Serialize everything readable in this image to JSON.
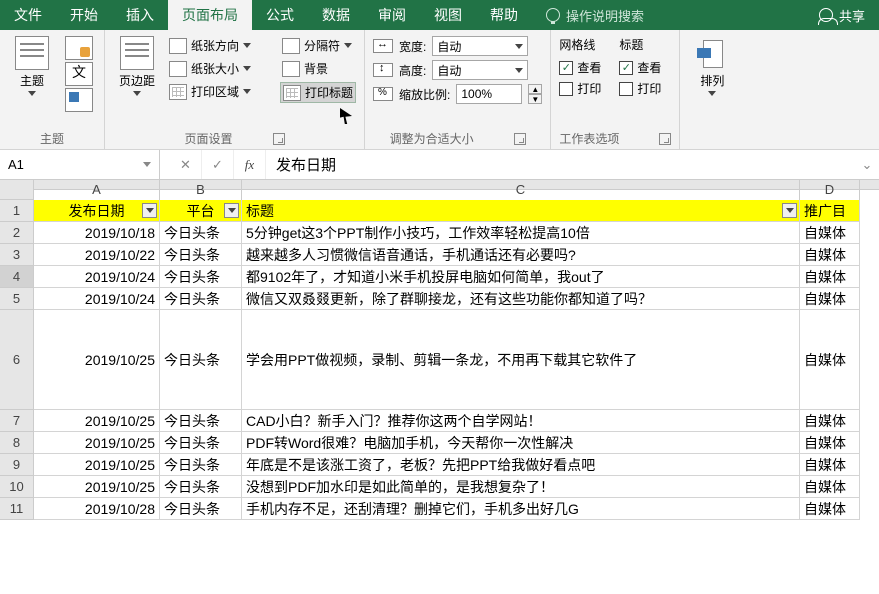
{
  "tabs": {
    "file": "文件",
    "home": "开始",
    "insert": "插入",
    "layout": "页面布局",
    "formulas": "公式",
    "data": "数据",
    "review": "审阅",
    "view": "视图",
    "help": "帮助",
    "tell": "操作说明搜索",
    "share": "共享"
  },
  "ribbon": {
    "themes": {
      "theme": "主题",
      "colors_icon": "colors-icon",
      "fonts_icon": "fonts-icon",
      "effects_icon": "effects-icon",
      "group": "主题"
    },
    "page": {
      "margins": "页边距",
      "orientation": "纸张方向",
      "size": "纸张大小",
      "printarea": "打印区域",
      "breaks": "分隔符",
      "background": "背景",
      "printtitles": "打印标题",
      "group": "页面设置"
    },
    "scale": {
      "width": "宽度:",
      "height": "高度:",
      "scale": "缩放比例:",
      "auto": "自动",
      "pct": "100%",
      "group": "调整为合适大小"
    },
    "options": {
      "gridlines": "网格线",
      "headings": "标题",
      "view": "查看",
      "print": "打印",
      "group": "工作表选项"
    },
    "arrange": {
      "arrange": "排列"
    }
  },
  "namebox": "A1",
  "formula": "发布日期",
  "columns": {
    "A": "A",
    "B": "B",
    "C": "C",
    "D": "D"
  },
  "headers": {
    "A": "发布日期",
    "B": "平台",
    "C": "标题",
    "D": "推广目"
  },
  "rows": [
    {
      "n": "2",
      "A": "2019/10/18",
      "B": "今日头条",
      "C": "5分钟get这3个PPT制作小技巧，工作效率轻松提高10倍",
      "D": "自媒体"
    },
    {
      "n": "3",
      "A": "2019/10/22",
      "B": "今日头条",
      "C": "越来越多人习惯微信语音通话，手机通话还有必要吗?",
      "D": "自媒体"
    },
    {
      "n": "4",
      "A": "2019/10/24",
      "B": "今日头条",
      "C": "都9102年了，才知道小米手机投屏电脑如何简单，我out了",
      "D": "自媒体"
    },
    {
      "n": "5",
      "A": "2019/10/24",
      "B": "今日头条",
      "C": "微信又双叒叕更新，除了群聊接龙，还有这些功能你都知道了吗？",
      "D": "自媒体"
    },
    {
      "n": "6",
      "A": "2019/10/25",
      "B": "今日头条",
      "C": "学会用PPT做视频，录制、剪辑一条龙，不用再下载其它软件了",
      "D": "自媒体",
      "tall": true
    },
    {
      "n": "7",
      "A": "2019/10/25",
      "B": "今日头条",
      "C": "CAD小白？新手入门？推荐你这两个自学网站！",
      "D": "自媒体"
    },
    {
      "n": "8",
      "A": "2019/10/25",
      "B": "今日头条",
      "C": "PDF转Word很难？电脑加手机，今天帮你一次性解决",
      "D": "自媒体"
    },
    {
      "n": "9",
      "A": "2019/10/25",
      "B": "今日头条",
      "C": "年底是不是该涨工资了，老板？先把PPT给我做好看点吧",
      "D": "自媒体"
    },
    {
      "n": "10",
      "A": "2019/10/25",
      "B": "今日头条",
      "C": "没想到PDF加水印是如此简单的，是我想复杂了！",
      "D": "自媒体"
    },
    {
      "n": "11",
      "A": "2019/10/28",
      "B": "今日头条",
      "C": "手机内存不足，还刮清理？删掉它们，手机多出好几G",
      "D": "自媒体"
    }
  ]
}
